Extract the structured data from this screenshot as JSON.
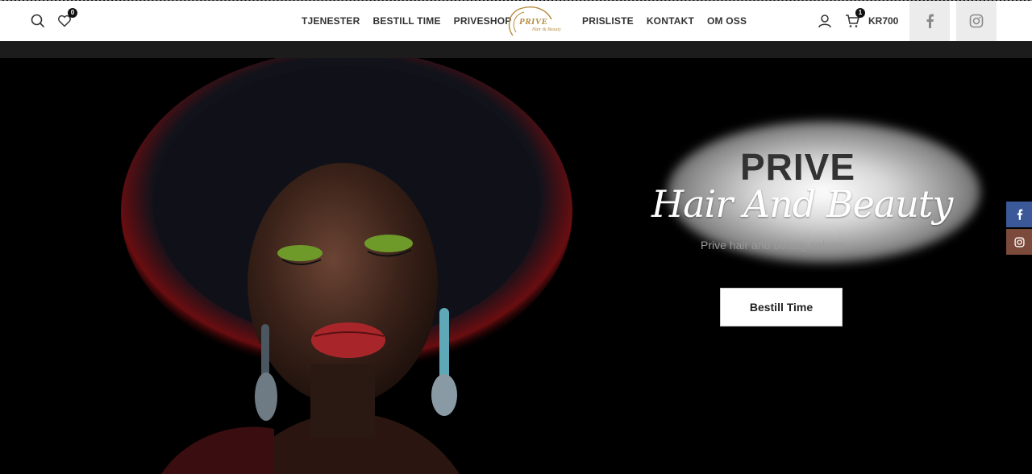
{
  "header": {
    "wishlist_count": "0",
    "nav_left": [
      "TJENESTER",
      "BESTILL TIME",
      "PRIVESHOP"
    ],
    "nav_right": [
      "PRISLISTE",
      "KONTAKT",
      "OM OSS"
    ],
    "logo": {
      "title": "PRIVE",
      "subtitle": "Hair & Beauty"
    },
    "cart_count": "1",
    "cart_amount": "KR700"
  },
  "hero": {
    "title": "PRIVE",
    "script": "Hair And Beauty",
    "subtitle": "Prive hair and beauty salone",
    "cta_label": "Bestill Time"
  },
  "colors": {
    "facebook": "#3b5998",
    "instagram": "#7b4a3a",
    "logo_gold": "#b48a3a"
  },
  "icons": [
    "search-icon",
    "heart-icon",
    "user-icon",
    "cart-icon",
    "facebook-icon",
    "instagram-icon"
  ]
}
